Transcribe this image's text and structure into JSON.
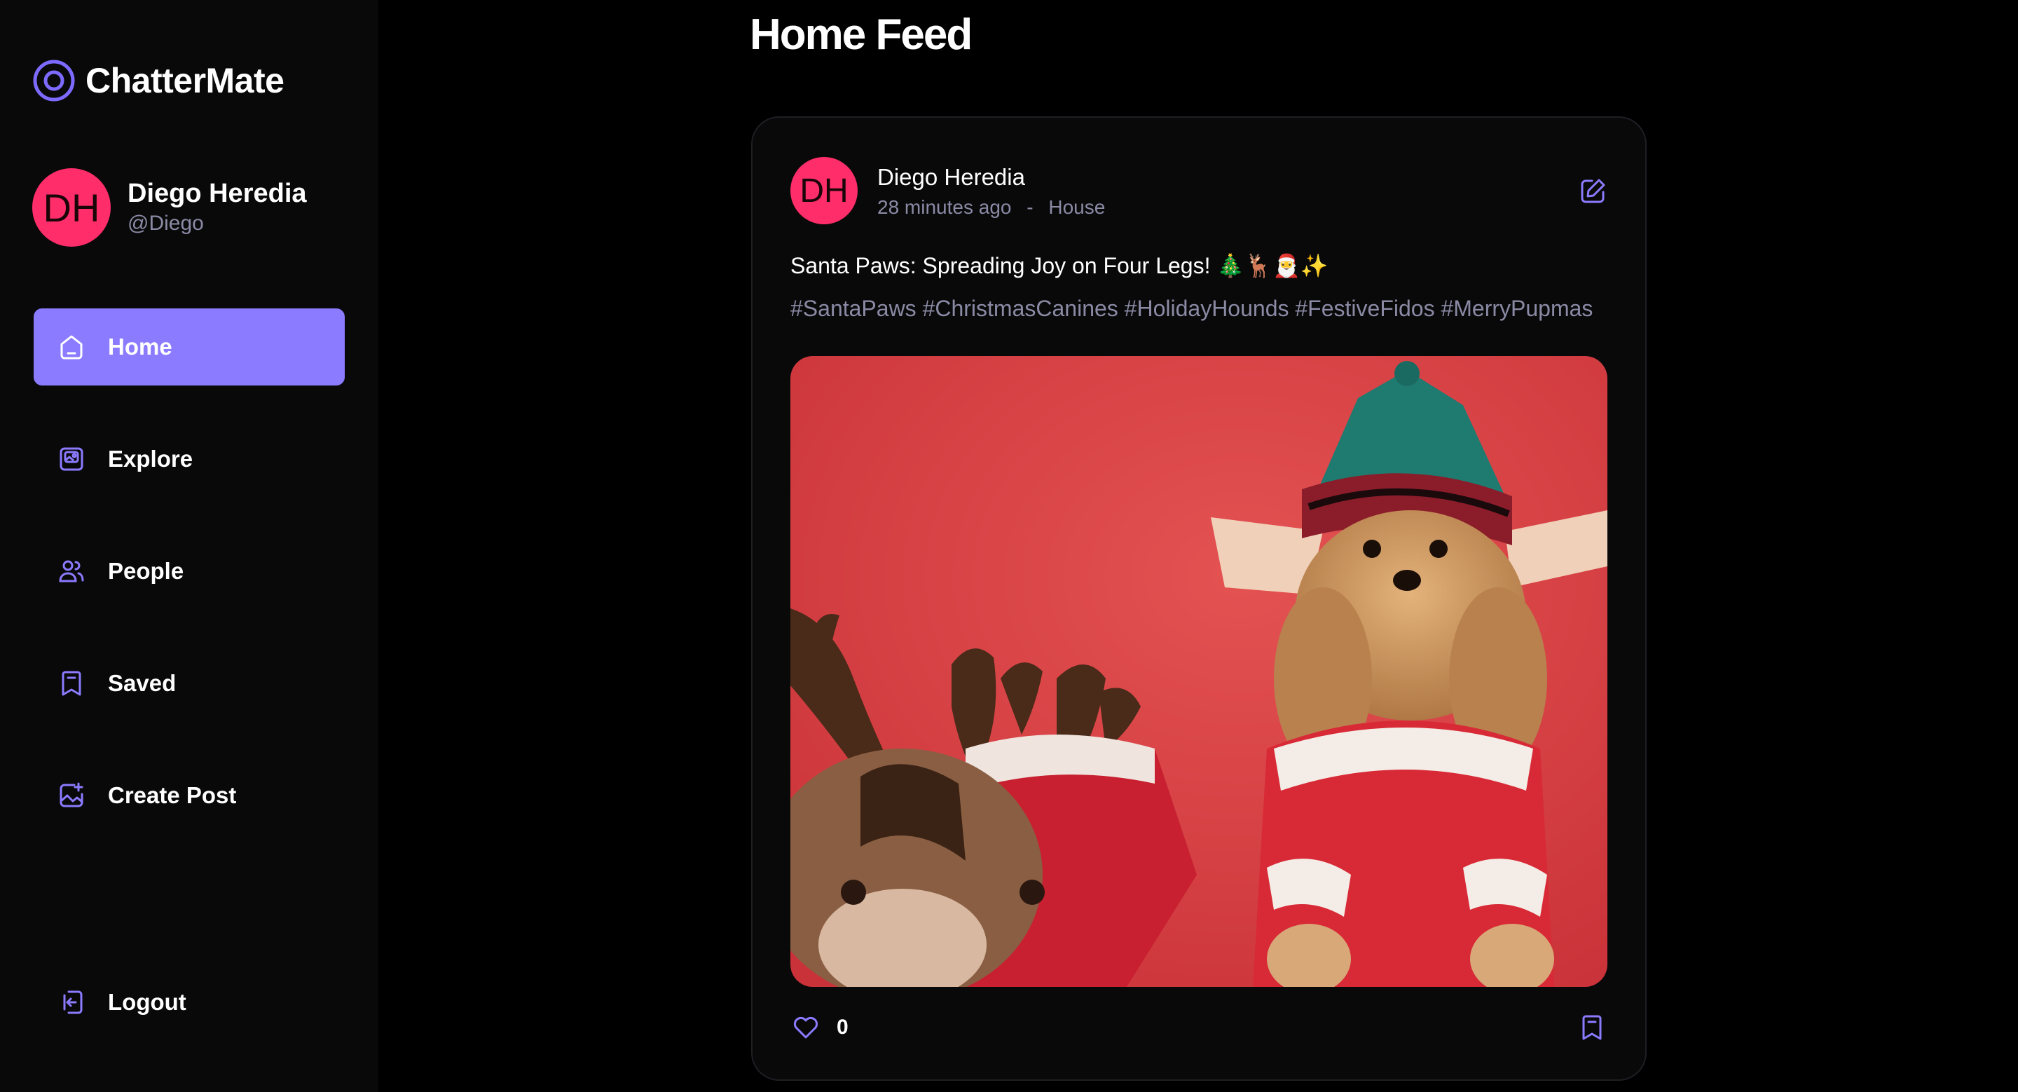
{
  "app": {
    "name": "ChatterMate"
  },
  "user": {
    "initials": "DH",
    "name": "Diego Heredia",
    "handle": "@Diego"
  },
  "nav": [
    {
      "label": "Home",
      "icon": "home-icon",
      "active": true
    },
    {
      "label": "Explore",
      "icon": "image-icon",
      "active": false
    },
    {
      "label": "People",
      "icon": "people-icon",
      "active": false
    },
    {
      "label": "Saved",
      "icon": "bookmark-icon",
      "active": false
    },
    {
      "label": "Create Post",
      "icon": "gallery-add-icon",
      "active": false
    }
  ],
  "logout": {
    "label": "Logout",
    "icon": "logout-icon"
  },
  "page": {
    "title": "Home Feed"
  },
  "post": {
    "author_initials": "DH",
    "author": "Diego Heredia",
    "time": "28 minutes ago",
    "separator": "-",
    "location": "House",
    "caption": "Santa Paws: Spreading Joy on Four Legs! 🎄🦌🎅✨",
    "tags": "#SantaPaws #ChristmasCanines #HolidayHounds #FestiveFidos #MerryPupmas",
    "likes": "0"
  },
  "colors": {
    "accent": "#8b7bff",
    "avatar": "#ff2d6a",
    "muted": "#8a8aa5"
  }
}
